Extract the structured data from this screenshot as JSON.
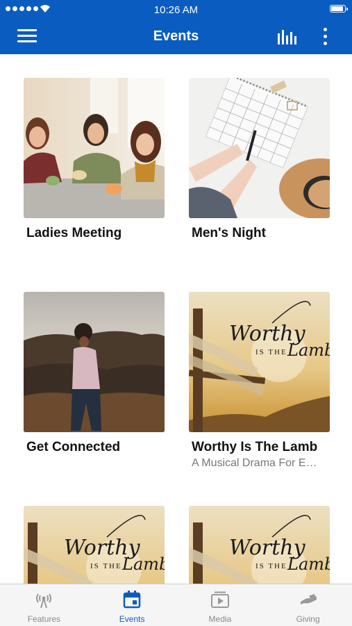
{
  "status_bar": {
    "time": "10:26 AM"
  },
  "header": {
    "title": "Events"
  },
  "events": [
    {
      "title": "Ladies Meeting",
      "subtitle": ""
    },
    {
      "title": "Men's Night",
      "subtitle": ""
    },
    {
      "title": "Get Connected",
      "subtitle": ""
    },
    {
      "title": "Worthy Is The Lamb",
      "subtitle": "A Musical Drama For E…"
    }
  ],
  "artwork_text": {
    "word1": "Worthy",
    "word2": "IS THE",
    "word3": "Lamb"
  },
  "tab_bar": {
    "tabs": [
      {
        "label": "Features",
        "icon": "broadcast-icon"
      },
      {
        "label": "Events",
        "icon": "calendar-icon"
      },
      {
        "label": "Media",
        "icon": "play-icon"
      },
      {
        "label": "Giving",
        "icon": "giving-icon"
      }
    ],
    "active_tab": "Events"
  },
  "colors": {
    "brand": "#0a5cc0",
    "tab_inactive": "#888888"
  }
}
